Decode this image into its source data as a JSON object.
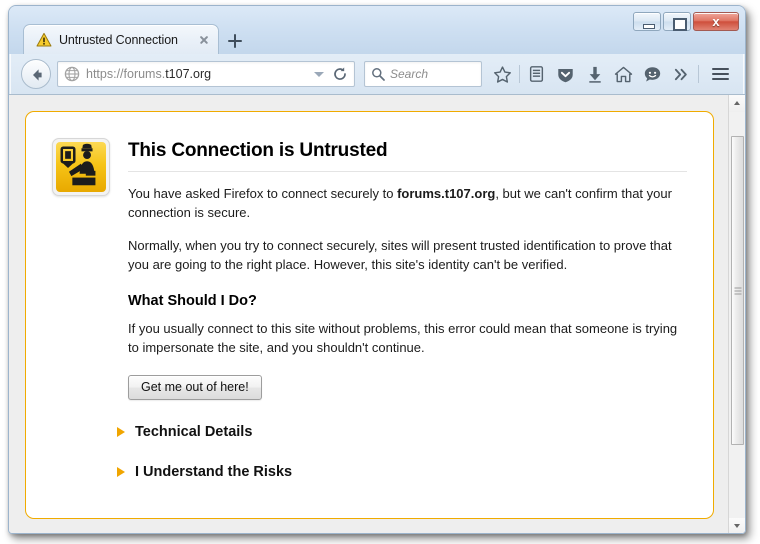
{
  "window": {
    "controls": {
      "minimize_label": "Minimize",
      "maximize_label": "Maximize",
      "close_label": "x"
    }
  },
  "tabbar": {
    "tabs": [
      {
        "title": "Untrusted Connection",
        "warning_icon": "warning-triangle-icon",
        "close_icon": "close-icon"
      }
    ],
    "new_tab_label": "+"
  },
  "navbar": {
    "back_icon": "back-arrow-icon",
    "url": {
      "prefix": "https://forums.",
      "domain": "t107.org",
      "full": "https://forums.t107.org",
      "identity_icon": "globe-icon",
      "dropdown_icon": "chevron-down-icon",
      "reload_icon": "reload-icon"
    },
    "search": {
      "placeholder": "Search",
      "icon": "search-icon"
    },
    "tools": [
      {
        "name": "bookmark-star-icon",
        "glyph": "star"
      },
      {
        "name": "reader-list-icon",
        "glyph": "list"
      },
      {
        "name": "pocket-shield-icon",
        "glyph": "shield"
      },
      {
        "name": "downloads-icon",
        "glyph": "down-arrow"
      },
      {
        "name": "home-icon",
        "glyph": "house"
      },
      {
        "name": "chat-icon",
        "glyph": "smiley"
      },
      {
        "name": "overflow-chevrons-icon",
        "glyph": "double-chevron"
      }
    ],
    "menu_icon": "hamburger-menu-icon"
  },
  "page": {
    "icon": "untrusted-officer-icon",
    "title": "This Connection is Untrusted",
    "paragraph1_before": "You have asked Firefox to connect securely to ",
    "paragraph1_domain": "forums.t107.org",
    "paragraph1_after": ", but we can't confirm that your connection is secure.",
    "paragraph2": "Normally, when you try to connect securely, sites will present trusted identification to prove that you are going to the right place. However, this site's identity can't be verified.",
    "subheading": "What Should I Do?",
    "paragraph3": "If you usually connect to this site without problems, this error could mean that someone is trying to impersonate the site, and you shouldn't continue.",
    "button_label": "Get me out of here!",
    "sections": [
      {
        "label": "Technical Details",
        "icon": "disclosure-triangle-icon"
      },
      {
        "label": "I Understand the Risks",
        "icon": "disclosure-triangle-icon"
      }
    ]
  },
  "colors": {
    "accent_yellow": "#f0ab00",
    "warning_icon_yellow": "#f6c417",
    "close_button_red": "#cf4f3c",
    "frame_blue": "#c2d8ee"
  }
}
